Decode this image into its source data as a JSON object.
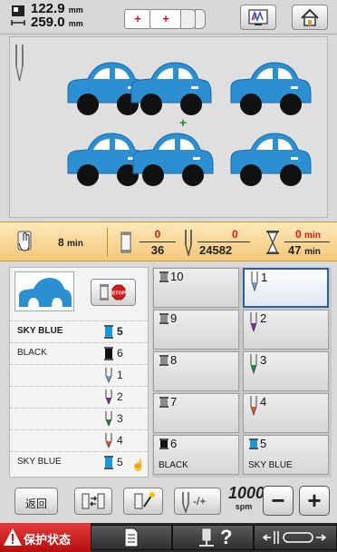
{
  "topbar": {
    "width_value": "122.9",
    "height_value": "259.0",
    "unit": "mm"
  },
  "stats": {
    "time_remaining": "8",
    "time_unit": "min",
    "color_current": "0",
    "color_total": "36",
    "stitch_current": "0",
    "stitch_total": "24582",
    "time_elapsed": "0",
    "time_total": "47",
    "min_label": "min"
  },
  "stop_label": "STOP",
  "color_list": [
    {
      "name": "SKY BLUE",
      "num": "5",
      "icon": "spool",
      "color": "#1a9ad6",
      "highlight": true
    },
    {
      "name": "BLACK",
      "num": "6",
      "icon": "spool",
      "color": "#111111",
      "highlight": false
    },
    {
      "name": "",
      "num": "1",
      "icon": "needle",
      "color": "#7a9fd1",
      "highlight": false
    },
    {
      "name": "",
      "num": "2",
      "icon": "needle",
      "color": "#7a2f9a",
      "highlight": false
    },
    {
      "name": "",
      "num": "3",
      "icon": "needle",
      "color": "#1f8a3a",
      "highlight": false
    },
    {
      "name": "",
      "num": "4",
      "icon": "needle",
      "color": "#e0572a",
      "highlight": false
    },
    {
      "name": "SKY BLUE",
      "num": "5",
      "icon": "spool",
      "color": "#1a9ad6",
      "highlight": false
    }
  ],
  "needle_bars": [
    {
      "num": "10",
      "name": "",
      "icon": "spool",
      "color": "#8a8a8a",
      "active": false
    },
    {
      "num": "1",
      "name": "",
      "icon": "needle",
      "color": "#7a9fd1",
      "active": true
    },
    {
      "num": "9",
      "name": "",
      "icon": "spool",
      "color": "#8a8a8a",
      "active": false
    },
    {
      "num": "2",
      "name": "",
      "icon": "needle",
      "color": "#7a2f9a",
      "active": false
    },
    {
      "num": "8",
      "name": "",
      "icon": "spool",
      "color": "#8a8a8a",
      "active": false
    },
    {
      "num": "3",
      "name": "",
      "icon": "needle",
      "color": "#1f8a3a",
      "active": false
    },
    {
      "num": "7",
      "name": "",
      "icon": "spool",
      "color": "#8a8a8a",
      "active": false
    },
    {
      "num": "4",
      "name": "",
      "icon": "needle",
      "color": "#e0572a",
      "active": false
    },
    {
      "num": "6",
      "name": "BLACK",
      "icon": "spool",
      "color": "#111111",
      "active": false
    },
    {
      "num": "5",
      "name": "SKY BLUE",
      "icon": "spool",
      "color": "#1a9ad6",
      "active": false
    }
  ],
  "controls": {
    "back_label": "返回",
    "speed_value": "1000",
    "speed_unit": "spm",
    "minus": "−",
    "plus": "+",
    "needle_toggle_label": "-/+"
  },
  "bottom": {
    "protect_label": "保护状态",
    "help_label": "?"
  },
  "colors": {
    "car_blue": "#2b8fd2",
    "active_border": "#2b5fa8",
    "stats_bg": "#f4c77a",
    "alert_red": "#c81a1a"
  }
}
